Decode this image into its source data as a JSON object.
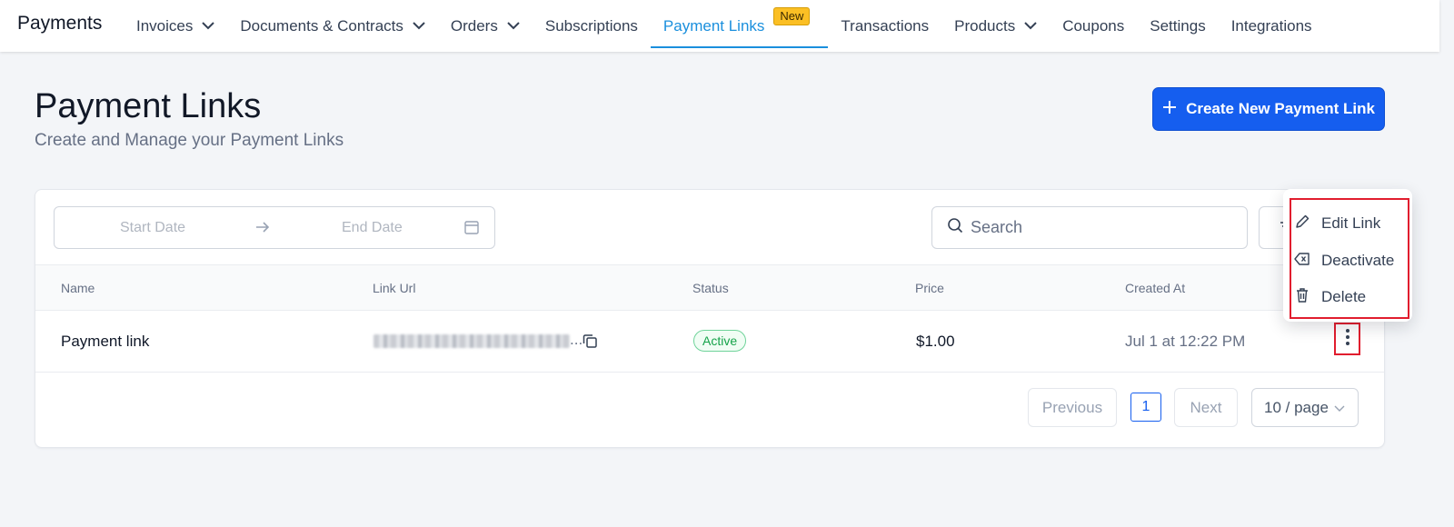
{
  "brand": "Payments",
  "nav": [
    {
      "label": "Invoices",
      "dropdown": true
    },
    {
      "label": "Documents & Contracts",
      "dropdown": true
    },
    {
      "label": "Orders",
      "dropdown": true
    },
    {
      "label": "Subscriptions",
      "dropdown": false
    },
    {
      "label": "Payment Links",
      "dropdown": false,
      "active": true,
      "badge": "New"
    },
    {
      "label": "Transactions",
      "dropdown": false
    },
    {
      "label": "Products",
      "dropdown": true
    },
    {
      "label": "Coupons",
      "dropdown": false
    },
    {
      "label": "Settings",
      "dropdown": false
    },
    {
      "label": "Integrations",
      "dropdown": false
    }
  ],
  "header": {
    "title": "Payment Links",
    "subtitle": "Create and Manage your Payment Links",
    "create_button": "Create New Payment Link"
  },
  "filters": {
    "start_placeholder": "Start Date",
    "end_placeholder": "End Date",
    "search_placeholder": "Search"
  },
  "table": {
    "columns": [
      "Name",
      "Link Url",
      "Status",
      "Price",
      "Created At"
    ],
    "rows": [
      {
        "name": "Payment link",
        "url_suffix": "...",
        "status": "Active",
        "price": "$1.00",
        "created_at": "Jul 1 at 12:22 PM"
      }
    ]
  },
  "pagination": {
    "previous": "Previous",
    "page": "1",
    "next": "Next",
    "per_page": "10 / page"
  },
  "menu": {
    "items": [
      {
        "label": "Edit Link",
        "icon": "pencil-icon"
      },
      {
        "label": "Deactivate",
        "icon": "backspace-icon"
      },
      {
        "label": "Delete",
        "icon": "trash-icon"
      }
    ]
  },
  "colors": {
    "primary": "#155eef",
    "active_tab": "#1a8fdd",
    "badge": "#fbbf24",
    "status_active": "#16a34a",
    "highlight": "#e11d2e"
  }
}
